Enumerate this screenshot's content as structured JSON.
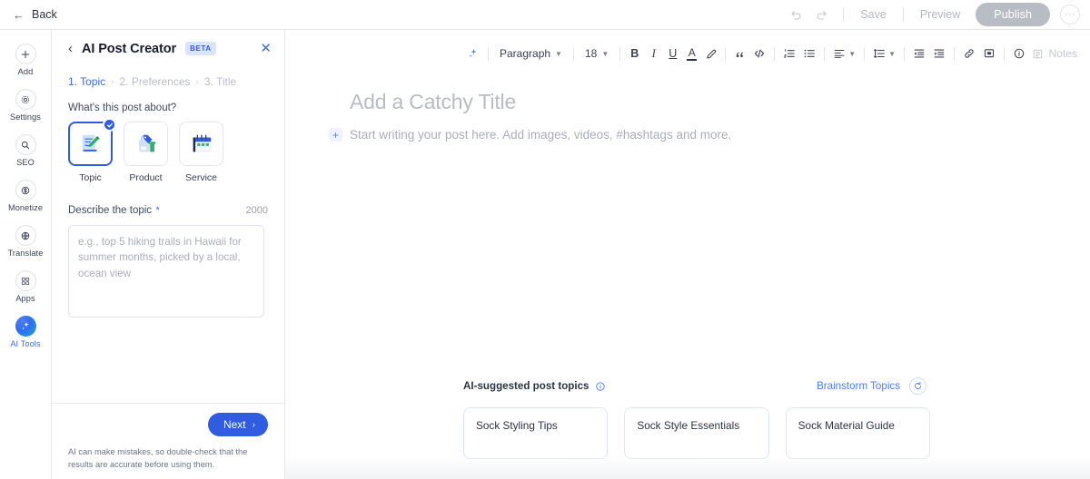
{
  "topbar": {
    "back_label": "Back",
    "back_icon": "arrow-left-icon",
    "undo_icon": "undo-icon",
    "redo_icon": "redo-icon",
    "save_label": "Save",
    "preview_label": "Preview",
    "publish_label": "Publish",
    "more_label": "···",
    "publish_color": "#b8bcc4"
  },
  "rail": {
    "items": [
      {
        "label": "Add",
        "icon": "plus-icon",
        "active": false
      },
      {
        "label": "Settings",
        "icon": "gear-icon",
        "active": false
      },
      {
        "label": "SEO",
        "icon": "search-icon",
        "active": false
      },
      {
        "label": "Monetize",
        "icon": "dollar-circle-icon",
        "active": false
      },
      {
        "label": "Translate",
        "icon": "globe-icon",
        "active": false
      },
      {
        "label": "Apps",
        "icon": "apps-grid-icon",
        "active": false
      },
      {
        "label": "AI Tools",
        "icon": "ai-sparkle-icon",
        "active": true
      }
    ],
    "active_color": "#3b6ef5"
  },
  "panel": {
    "back_icon": "chevron-left-icon",
    "title": "AI Post Creator",
    "badge": "BETA",
    "close_icon": "close-icon",
    "steps": [
      {
        "label": "1.  Topic",
        "active": true
      },
      {
        "label": "2.  Preferences",
        "active": false
      },
      {
        "label": "3.  Title",
        "active": false
      }
    ],
    "step_separator": "›",
    "post_about_label": "What's this post about?",
    "types": [
      {
        "name": "Topic",
        "icon": "document-pen-icon",
        "selected": true
      },
      {
        "name": "Product",
        "icon": "shopping-bag-icon",
        "selected": false
      },
      {
        "name": "Service",
        "icon": "calendar-icon",
        "selected": false
      }
    ],
    "describe_label": "Describe the topic",
    "required_mark": "*",
    "char_counter": "2000",
    "describe_value": "",
    "describe_placeholder": "e.g., top 5 hiking trails in Hawaii for summer months, picked by a local, ocean view",
    "next_label": "Next",
    "next_icon": "chevron-right-icon",
    "disclaimer": "AI can make mistakes, so double-check that the results are accurate before using them.",
    "accent_color": "#2f5ce0"
  },
  "editor": {
    "toolbar": {
      "ai_icon": "ai-sparkle-icon",
      "paragraph_label": "Paragraph",
      "font_size": "18",
      "bold_label": "B",
      "italic_label": "I",
      "underline_label": "U",
      "text_color_label": "A",
      "highlight_icon": "highlighter-icon",
      "quote_icon": "quote-icon",
      "code_icon": "code-icon",
      "ordered_list_icon": "numbered-list-icon",
      "bullet_list_icon": "bullet-list-icon",
      "align_icon": "align-left-icon",
      "line_height_icon": "line-height-icon",
      "indent_decrease_icon": "indent-decrease-icon",
      "indent_increase_icon": "indent-increase-icon",
      "link_icon": "link-icon",
      "comment_icon": "comment-icon",
      "info_icon": "info-circle-icon",
      "notes_label": "Notes",
      "notes_icon": "notes-icon"
    },
    "title_placeholder": "Add a Catchy Title",
    "body_placeholder": "Start writing your post here. Add images, videos, #hashtags and more.",
    "add_block_label": "+",
    "suggestions": {
      "heading": "AI-suggested post topics",
      "info_icon": "info-circle-icon",
      "brainstorm_label": "Brainstorm Topics",
      "refresh_icon": "refresh-icon",
      "items": [
        {
          "label": "Sock Styling Tips"
        },
        {
          "label": "Sock Style Essentials"
        },
        {
          "label": "Sock Material Guide"
        }
      ]
    }
  }
}
